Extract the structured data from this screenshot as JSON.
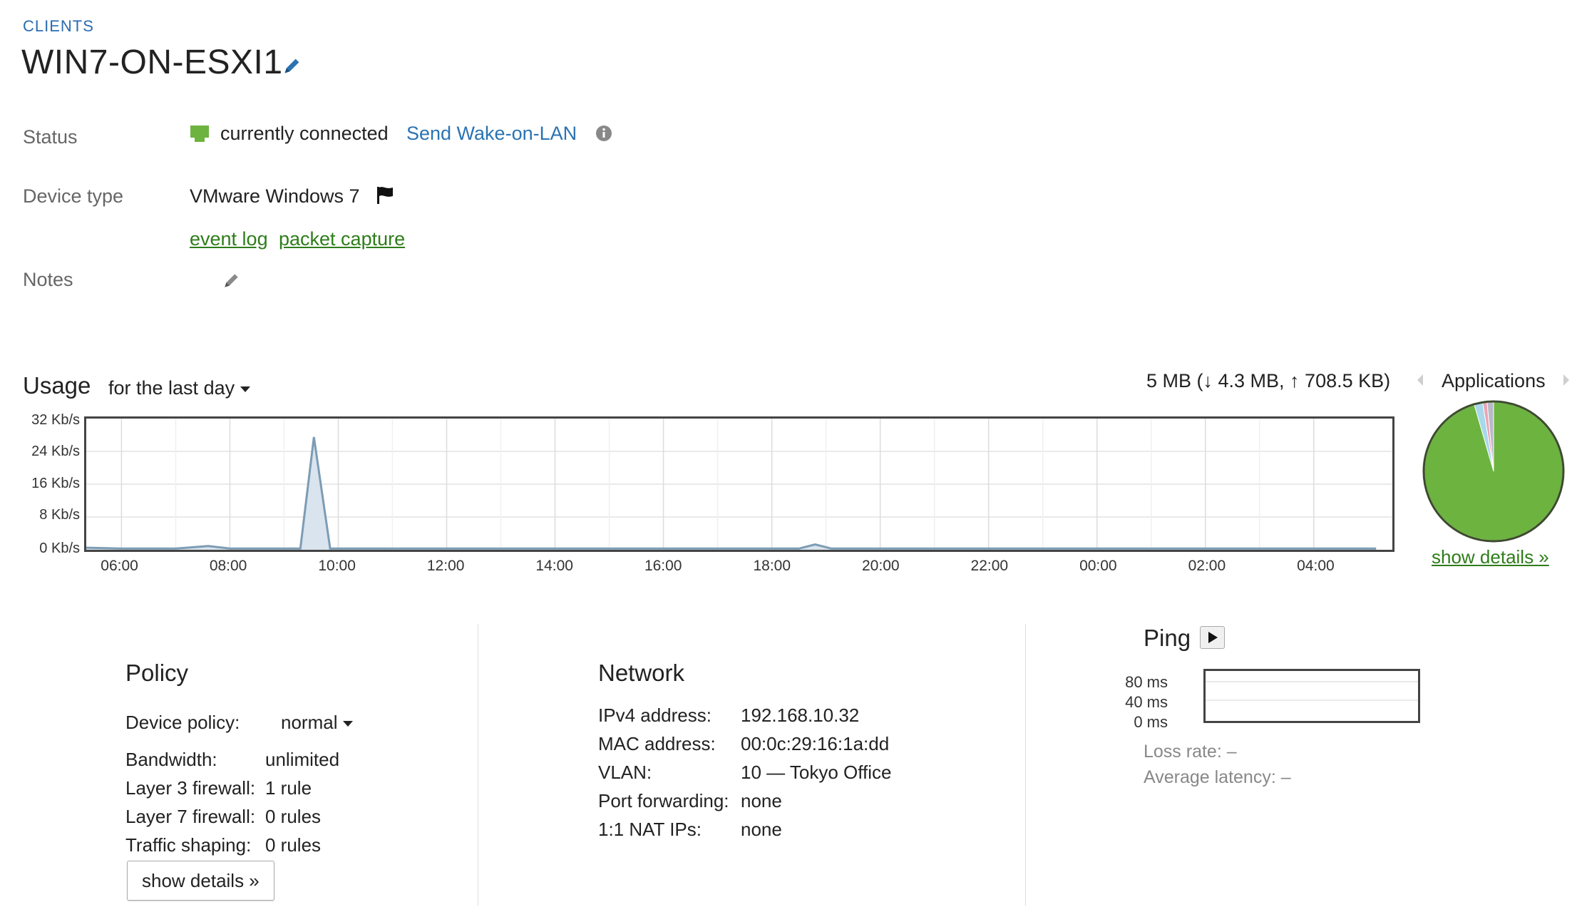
{
  "breadcrumb": "CLIENTS",
  "title": "WIN7-ON-ESXI1",
  "status": {
    "label": "Status",
    "value": "currently connected",
    "wake_link": "Send Wake-on-LAN"
  },
  "device_type": {
    "label": "Device type",
    "value": "VMware Windows 7"
  },
  "links": {
    "event_log": "event log",
    "packet_capture": "packet capture"
  },
  "notes": {
    "label": "Notes"
  },
  "usage": {
    "title": "Usage",
    "range": "for the last day",
    "total": "5 MB (↓ 4.3 MB, ↑ 708.5 KB)"
  },
  "chart_data": {
    "type": "area",
    "y_ticks": [
      "32 Kb/s",
      "24 Kb/s",
      "16 Kb/s",
      "8 Kb/s",
      "0 Kb/s"
    ],
    "x_ticks": [
      "06:00",
      "08:00",
      "10:00",
      "12:00",
      "14:00",
      "16:00",
      "18:00",
      "20:00",
      "22:00",
      "00:00",
      "02:00",
      "04:00"
    ],
    "ylim": [
      0,
      32
    ],
    "xlim": [
      5.35,
      29.45
    ],
    "series": [
      {
        "x": [
          5.35,
          6.0,
          7.0,
          7.6,
          8.0,
          9.0,
          9.3,
          9.55,
          9.85,
          10.0,
          12.0,
          14.0,
          16.0,
          18.0,
          18.5,
          18.8,
          19.1,
          20.0,
          22.0,
          24.0,
          26.0,
          28.0,
          29.15
        ],
        "y": [
          0.5,
          0.3,
          0.3,
          0.9,
          0.3,
          0.3,
          0.3,
          27.5,
          0.3,
          0.3,
          0.3,
          0.3,
          0.3,
          0.3,
          0.3,
          1.3,
          0.3,
          0.3,
          0.3,
          0.3,
          0.3,
          0.3,
          0.3
        ]
      }
    ],
    "grid": true
  },
  "applications": {
    "title": "Applications",
    "show_details": "show details »",
    "pie": [
      {
        "share": 0.955,
        "color": "#6cb33f"
      },
      {
        "share": 0.02,
        "color": "#a8d8ea"
      },
      {
        "share": 0.01,
        "color": "#e8a5b5"
      },
      {
        "share": 0.015,
        "color": "#b9b9c8"
      }
    ]
  },
  "policy": {
    "title": "Policy",
    "device_policy_label": "Device policy:",
    "device_policy_value": "normal",
    "rows": [
      {
        "label": "Bandwidth:",
        "value": "unlimited"
      },
      {
        "label": "Layer 3 firewall:",
        "value": "1 rule"
      },
      {
        "label": "Layer 7 firewall:",
        "value": "0 rules"
      },
      {
        "label": "Traffic shaping:",
        "value": "0 rules"
      }
    ],
    "show_details": "show details »"
  },
  "network": {
    "title": "Network",
    "rows": [
      {
        "label": "IPv4 address:",
        "value": "192.168.10.32"
      },
      {
        "label": "MAC address:",
        "value": "00:0c:29:16:1a:dd"
      },
      {
        "label": "VLAN:",
        "value": "10 — Tokyo Office"
      },
      {
        "label": "Port forwarding:",
        "value": "none"
      },
      {
        "label": "1:1 NAT IPs:",
        "value": "none"
      }
    ]
  },
  "ping": {
    "title": "Ping",
    "y_ticks": [
      "80 ms",
      "40 ms",
      "0 ms"
    ],
    "loss_rate": "Loss rate: –",
    "avg_latency": "Average latency: –"
  },
  "colors": {
    "link_blue": "#2a73b2",
    "link_green": "#2e7d1a",
    "connected_green": "#6cb33f",
    "area_fill": "#d9e4ee",
    "area_line": "#7c9cb4"
  }
}
